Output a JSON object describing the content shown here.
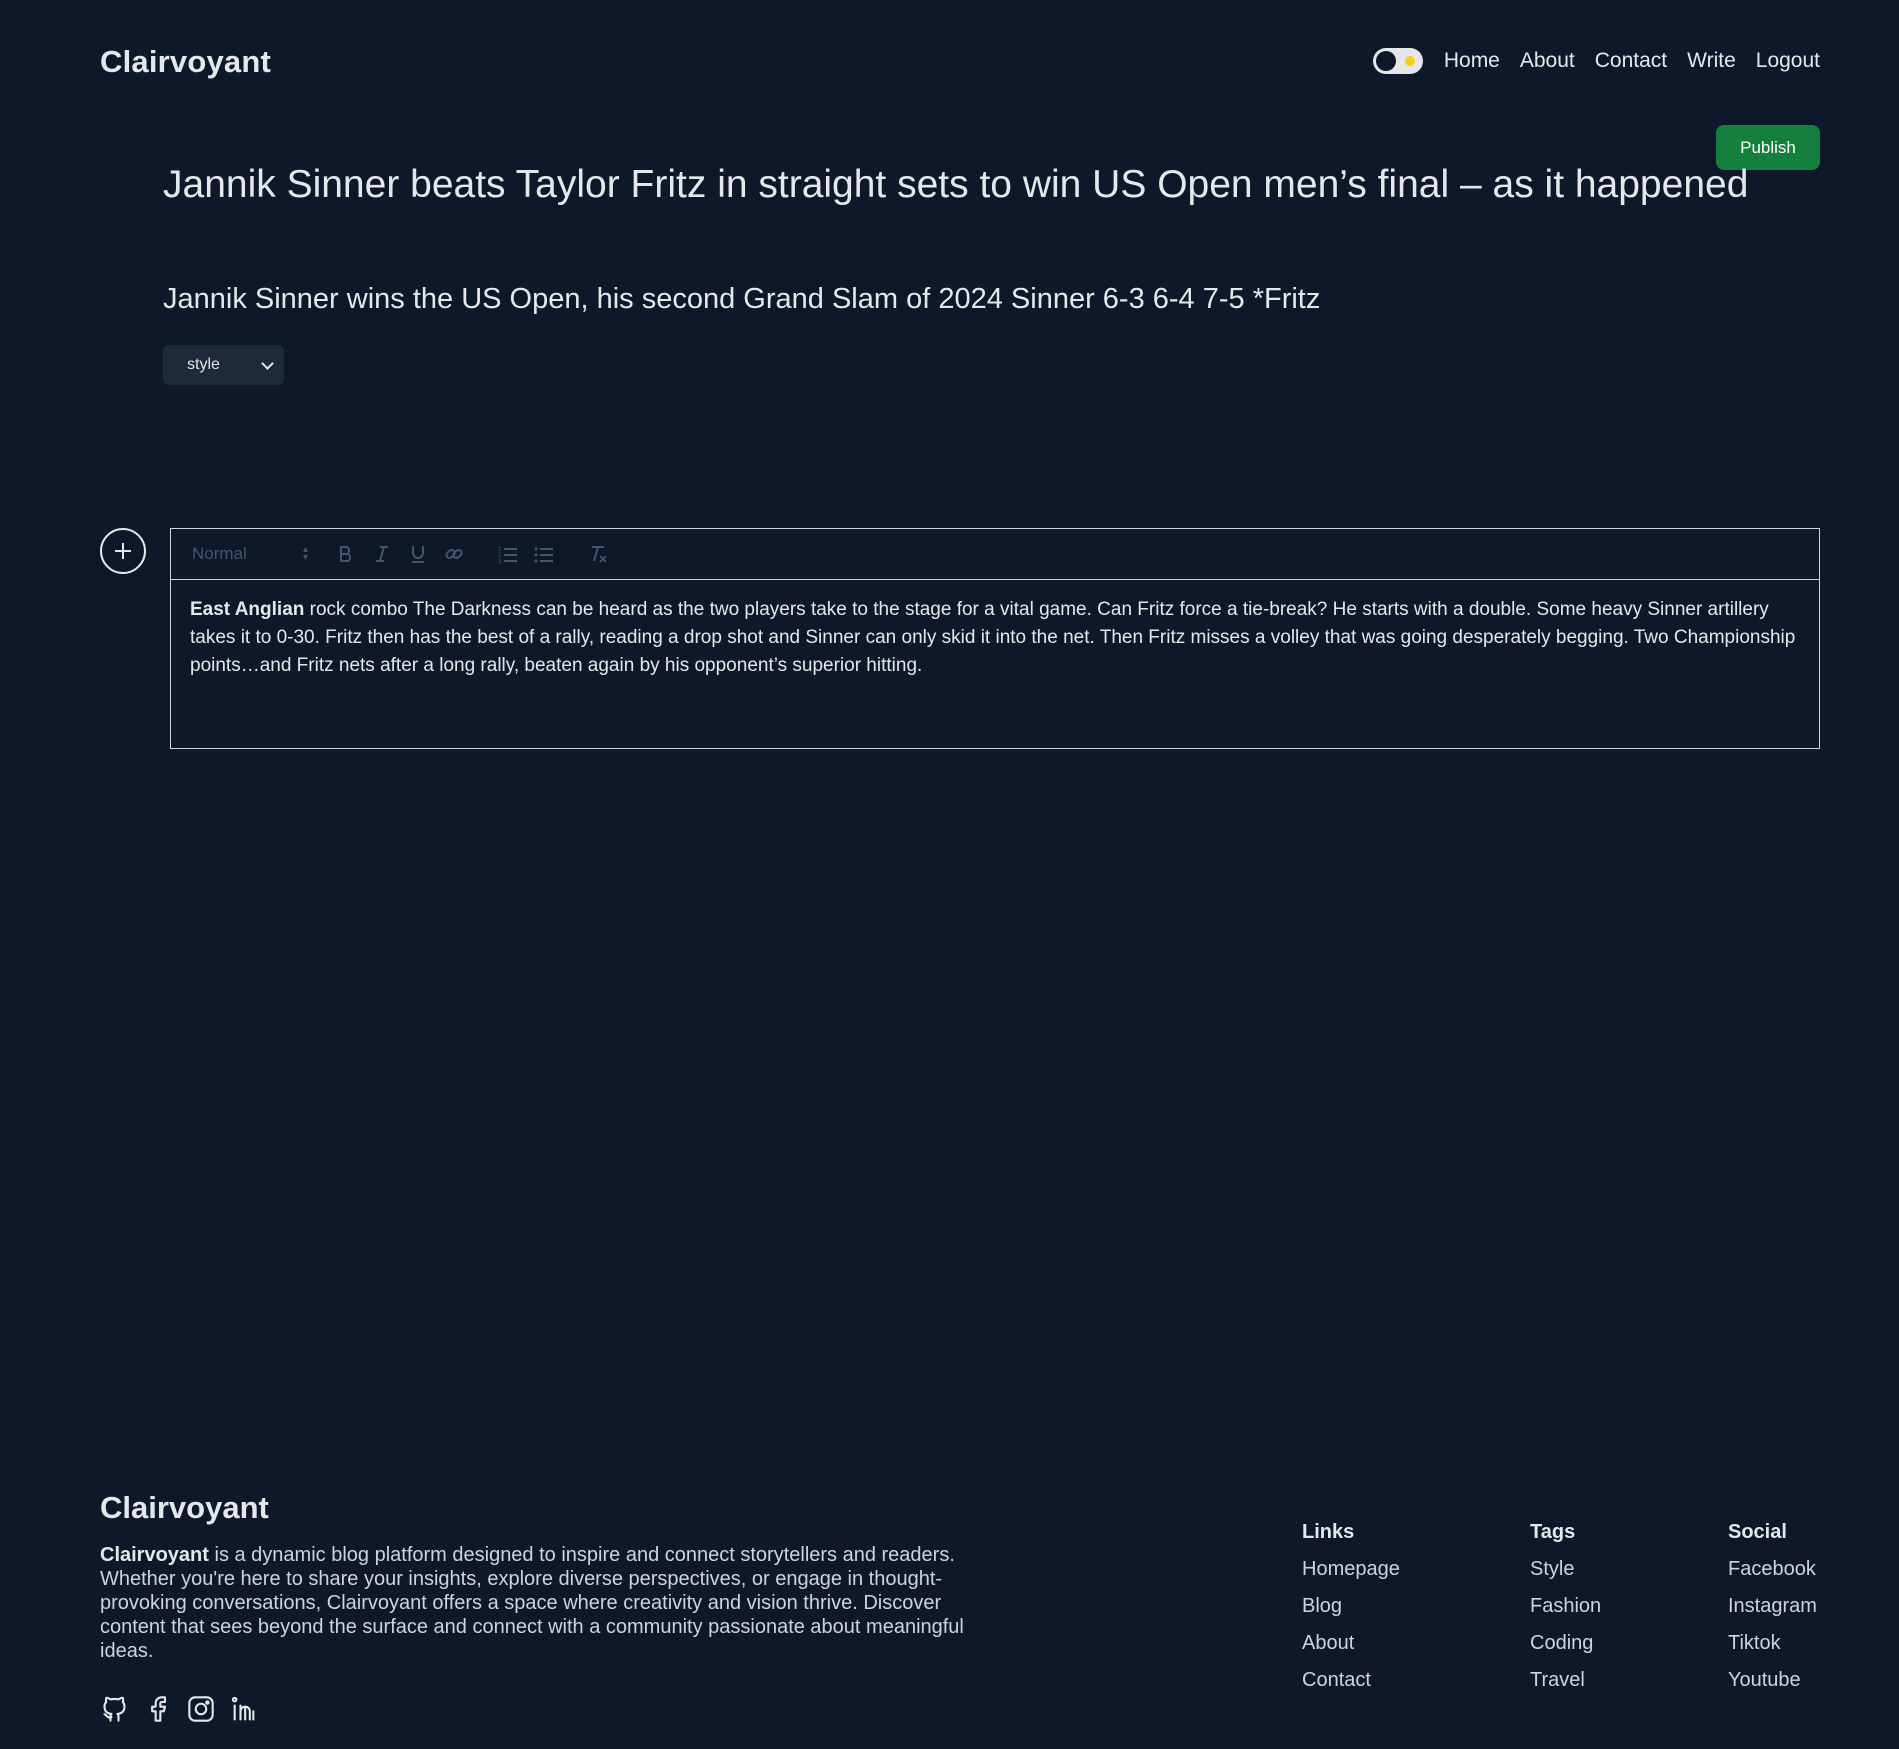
{
  "brand": "Clairvoyant",
  "nav": {
    "items": [
      "Home",
      "About",
      "Contact",
      "Write",
      "Logout"
    ]
  },
  "publish_label": "Publish",
  "post": {
    "title": "Jannik Sinner beats Taylor Fritz in straight sets to win US Open men’s final – as it happened",
    "subtitle": "Jannik Sinner wins the US Open, his second Grand Slam of 2024 Sinner 6-3 6-4 7-5 *Fritz",
    "style_select": "style"
  },
  "editor": {
    "heading_select": "Normal",
    "body_bold": "East Anglian",
    "body_text": " rock combo The Darkness can be heard as the two players take to the stage for a vital game. Can Fritz force a tie-break? He starts with a double. Some heavy Sinner artillery takes it to 0-30. Fritz then has the best of a rally, reading a drop shot and Sinner can only skid it into the net. Then Fritz misses a volley that was going desperately begging. Two Championship points…and Fritz nets after a long rally, beaten again by his opponent’s superior hitting."
  },
  "footer": {
    "brand": "Clairvoyant",
    "desc_bold": "Clairvoyant",
    "desc_text": " is a dynamic blog platform designed to inspire and connect storytellers and readers. Whether you're here to share your insights, explore diverse perspectives, or engage in thought-provoking conversations, Clairvoyant offers a space where creativity and vision thrive. Discover content that sees beyond the surface and connect with a community passionate about meaningful ideas.",
    "columns": [
      {
        "title": "Links",
        "items": [
          "Homepage",
          "Blog",
          "About",
          "Contact"
        ]
      },
      {
        "title": "Tags",
        "items": [
          "Style",
          "Fashion",
          "Coding",
          "Travel"
        ]
      },
      {
        "title": "Social",
        "items": [
          "Facebook",
          "Instagram",
          "Tiktok",
          "Youtube"
        ]
      }
    ],
    "social_icons": [
      "github-icon",
      "facebook-icon",
      "instagram-icon",
      "linkedin-icon"
    ]
  },
  "colors": {
    "background": "#0f172a",
    "publish": "#15803d",
    "toggle_sun": "#facc15"
  }
}
